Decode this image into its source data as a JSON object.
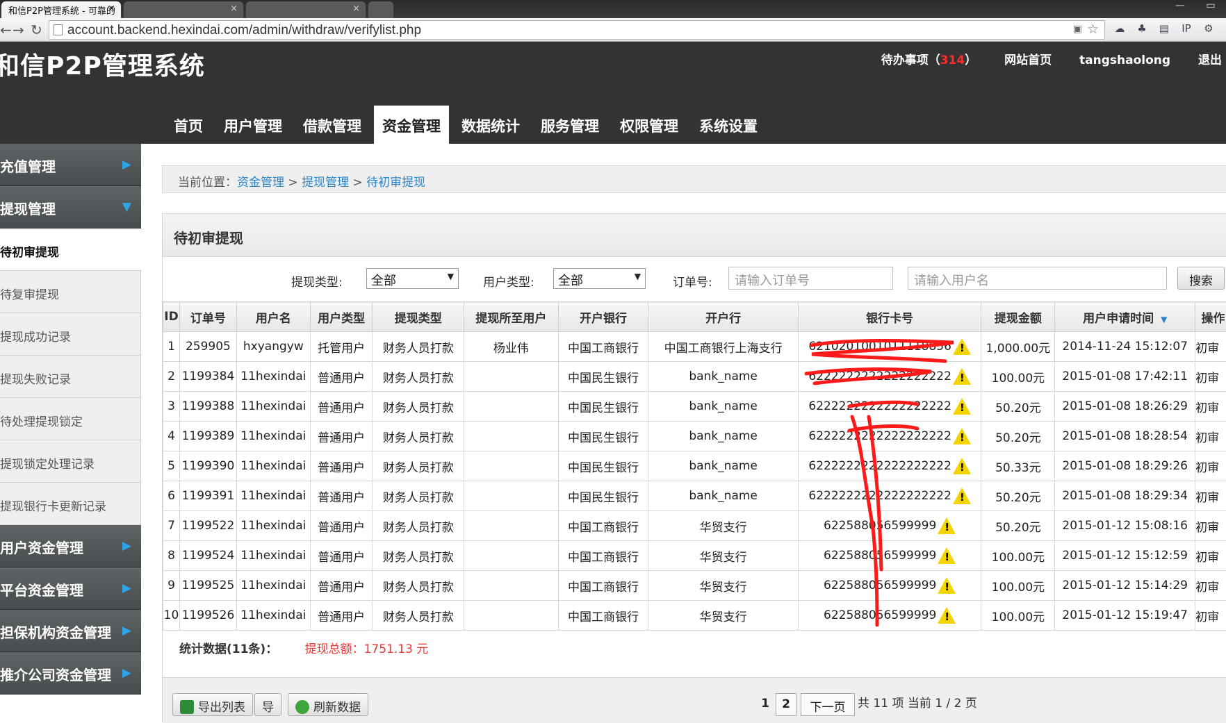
{
  "browser": {
    "tabs": [
      {
        "title": "和信P2P管理系统 - 可靠的",
        "active": true
      },
      {
        "title": "",
        "active": false
      },
      {
        "title": "",
        "active": false
      }
    ],
    "url": "account.backend.hexindai.com/admin/withdraw/verifylist.php"
  },
  "header": {
    "brand": "和信P2P管理系统",
    "todo_label": "待办事项（",
    "todo_count": "314",
    "todo_close": "）",
    "home_link": "网站首页",
    "username": "tangshaolong",
    "logout": "退出"
  },
  "nav": [
    "首页",
    "用户管理",
    "借款管理",
    "资金管理",
    "数据统计",
    "服务管理",
    "权限管理",
    "系统设置"
  ],
  "sidebar": {
    "sections": [
      {
        "label": "充值管理",
        "expanded": false
      },
      {
        "label": "提现管理",
        "expanded": true
      }
    ],
    "items": [
      "待初审提现",
      "待复审提现",
      "提现成功记录",
      "提现失败记录",
      "待处理提现锁定",
      "提现锁定处理记录",
      "提现银行卡更新记录"
    ],
    "sections_after": [
      "用户资金管理",
      "平台资金管理",
      "担保机构资金管理",
      "推介公司资金管理"
    ]
  },
  "breadcrumb": {
    "prefix": "当前位置：",
    "items": [
      "资金管理",
      "提现管理",
      "待初审提现"
    ],
    "sep": " > "
  },
  "panel": {
    "title": "待初审提现"
  },
  "filters": {
    "withdraw_type_label": "提现类型:",
    "withdraw_type_value": "全部",
    "user_type_label": "用户类型:",
    "user_type_value": "全部",
    "order_label": "订单号:",
    "order_placeholder": "请输入订单号",
    "username_placeholder": "请输入用户名",
    "search": "搜索"
  },
  "table": {
    "columns": [
      "ID",
      "订单号",
      "用户名",
      "用户类型",
      "提现类型",
      "提现所至用户",
      "开户银行",
      "开户行",
      "银行卡号",
      "提现金额",
      "用户申请时间",
      "操作"
    ],
    "rows": [
      {
        "id": "1",
        "order": "259905",
        "user": "hxyangyw",
        "utype": "托管用户",
        "wtype": "财务人员打款",
        "to_user": "杨业伟",
        "bank": "中国工商银行",
        "branch": "中国工商银行上海支行",
        "card": "6210201001011118856",
        "amount": "1,000.00元",
        "time": "2014-11-24 15:12:07",
        "op": "初审"
      },
      {
        "id": "2",
        "order": "1199384",
        "user": "11hexindai",
        "utype": "普通用户",
        "wtype": "财务人员打款",
        "to_user": "",
        "bank": "中国民生银行",
        "branch": "bank_name",
        "card": "6222222222222222222",
        "amount": "100.00元",
        "time": "2015-01-08 17:42:11",
        "op": "初审"
      },
      {
        "id": "3",
        "order": "1199388",
        "user": "11hexindai",
        "utype": "普通用户",
        "wtype": "财务人员打款",
        "to_user": "",
        "bank": "中国民生银行",
        "branch": "bank_name",
        "card": "6222222222222222222",
        "amount": "50.20元",
        "time": "2015-01-08 18:26:29",
        "op": "初审"
      },
      {
        "id": "4",
        "order": "1199389",
        "user": "11hexindai",
        "utype": "普通用户",
        "wtype": "财务人员打款",
        "to_user": "",
        "bank": "中国民生银行",
        "branch": "bank_name",
        "card": "6222222222222222222",
        "amount": "50.20元",
        "time": "2015-01-08 18:28:54",
        "op": "初审"
      },
      {
        "id": "5",
        "order": "1199390",
        "user": "11hexindai",
        "utype": "普通用户",
        "wtype": "财务人员打款",
        "to_user": "",
        "bank": "中国民生银行",
        "branch": "bank_name",
        "card": "6222222222222222222",
        "amount": "50.33元",
        "time": "2015-01-08 18:29:26",
        "op": "初审"
      },
      {
        "id": "6",
        "order": "1199391",
        "user": "11hexindai",
        "utype": "普通用户",
        "wtype": "财务人员打款",
        "to_user": "",
        "bank": "中国民生银行",
        "branch": "bank_name",
        "card": "6222222222222222222",
        "amount": "50.20元",
        "time": "2015-01-08 18:29:34",
        "op": "初审"
      },
      {
        "id": "7",
        "order": "1199522",
        "user": "11hexindai",
        "utype": "普通用户",
        "wtype": "财务人员打款",
        "to_user": "",
        "bank": "中国工商银行",
        "branch": "华贸支行",
        "card": "622588056599999",
        "amount": "50.20元",
        "time": "2015-01-12 15:08:16",
        "op": "初审"
      },
      {
        "id": "8",
        "order": "1199524",
        "user": "11hexindai",
        "utype": "普通用户",
        "wtype": "财务人员打款",
        "to_user": "",
        "bank": "中国工商银行",
        "branch": "华贸支行",
        "card": "622588056599999",
        "amount": "100.00元",
        "time": "2015-01-12 15:12:59",
        "op": "初审"
      },
      {
        "id": "9",
        "order": "1199525",
        "user": "11hexindai",
        "utype": "普通用户",
        "wtype": "财务人员打款",
        "to_user": "",
        "bank": "中国工商银行",
        "branch": "华贸支行",
        "card": "622588056599999",
        "amount": "100.00元",
        "time": "2015-01-12 15:14:29",
        "op": "初审"
      },
      {
        "id": "10",
        "order": "1199526",
        "user": "11hexindai",
        "utype": "普通用户",
        "wtype": "财务人员打款",
        "to_user": "",
        "bank": "中国工商银行",
        "branch": "华贸支行",
        "card": "622588056599999",
        "amount": "100.00元",
        "time": "2015-01-12 15:19:47",
        "op": "初审"
      }
    ]
  },
  "summary": {
    "label": "统计数据(11条)：",
    "total": "提现总额：1751.13 元"
  },
  "footer": {
    "export": "导出列表",
    "export2": "导",
    "refresh": "刷新数据",
    "pages": [
      "1",
      "2"
    ],
    "next": "下一页",
    "info": "共 11 项 当前 1 / 2 页"
  },
  "colors": {
    "header_bg": "#333333",
    "accent": "#2a86c9",
    "alert": "#e33333",
    "arrow": "#2ea4e7"
  },
  "icons": {
    "warning": "warning-icon",
    "excel": "excel-icon",
    "refresh": "refresh-icon"
  }
}
